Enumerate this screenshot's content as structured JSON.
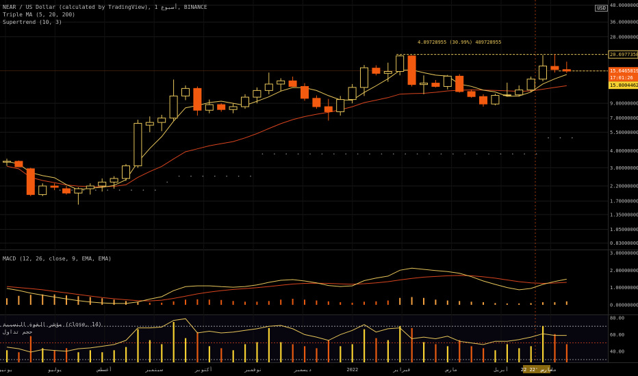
{
  "legend": {
    "main": [
      "NEAR / US Dollar (calculated by TradingView), أسبوع 1, BINANCE",
      "Triple MA (5, 20, 200)",
      "Supertrend (10, 3)"
    ],
    "macd": "MACD (12, 26, close, 9, EMA, EMA)",
    "rsi": [
      "مؤشر القوة النسبية (close, 14)",
      "حجم تداول"
    ]
  },
  "currency_badge": "USD",
  "colors": {
    "up": "#e8c65a",
    "down": "#f25a10",
    "ma_short": "#e8c65a",
    "ma_long": "#d8441e",
    "grid": "#1a1a1a",
    "dash": "#e8c65a"
  },
  "chart_data": {
    "type": "candlestick",
    "price_axis_ticks": [
      "48.00000000",
      "36.00000000",
      "28.00000000",
      "9.00000000",
      "7.00000000",
      "5.50000000",
      "4.00000000",
      "3.00000000",
      "2.20000000",
      "1.70000000",
      "1.35000000",
      "1.05000000",
      "0.83000000"
    ],
    "price_labels": {
      "top": "20.69773581",
      "current": "15.64658195",
      "countdown": "17:01:26",
      "stop": "15.80044625"
    },
    "measure_label": "4.89728955 (30.99%) 489728955",
    "candles": [
      {
        "o": 3.3,
        "h": 3.5,
        "l": 3.1,
        "c": 3.35
      },
      {
        "o": 3.35,
        "h": 3.4,
        "l": 3.05,
        "c": 3.05
      },
      {
        "o": 2.95,
        "h": 3.0,
        "l": 1.85,
        "c": 1.9
      },
      {
        "o": 1.9,
        "h": 2.3,
        "l": 1.85,
        "c": 2.2
      },
      {
        "o": 2.2,
        "h": 2.3,
        "l": 2.05,
        "c": 2.15
      },
      {
        "o": 2.1,
        "h": 2.2,
        "l": 1.9,
        "c": 1.95
      },
      {
        "o": 1.95,
        "h": 2.15,
        "l": 1.6,
        "c": 2.1
      },
      {
        "o": 2.1,
        "h": 2.3,
        "l": 1.9,
        "c": 2.2
      },
      {
        "o": 2.2,
        "h": 2.5,
        "l": 2.0,
        "c": 2.35
      },
      {
        "o": 2.35,
        "h": 2.6,
        "l": 2.1,
        "c": 2.5
      },
      {
        "o": 2.5,
        "h": 3.2,
        "l": 2.4,
        "c": 3.1
      },
      {
        "o": 3.1,
        "h": 6.8,
        "l": 3.0,
        "c": 6.4
      },
      {
        "o": 6.2,
        "h": 7.2,
        "l": 5.5,
        "c": 6.5
      },
      {
        "o": 6.5,
        "h": 7.4,
        "l": 5.6,
        "c": 7.0
      },
      {
        "o": 7.0,
        "h": 13.5,
        "l": 6.7,
        "c": 10.2
      },
      {
        "o": 10.2,
        "h": 12.2,
        "l": 9.5,
        "c": 11.6
      },
      {
        "o": 11.6,
        "h": 12.0,
        "l": 7.3,
        "c": 8.0
      },
      {
        "o": 8.0,
        "h": 9.6,
        "l": 7.6,
        "c": 8.8
      },
      {
        "o": 8.8,
        "h": 9.0,
        "l": 7.8,
        "c": 8.1
      },
      {
        "o": 8.1,
        "h": 9.0,
        "l": 7.6,
        "c": 8.5
      },
      {
        "o": 8.5,
        "h": 10.5,
        "l": 8.2,
        "c": 10.0
      },
      {
        "o": 10.0,
        "h": 11.8,
        "l": 9.0,
        "c": 11.2
      },
      {
        "o": 11.2,
        "h": 15.2,
        "l": 10.5,
        "c": 12.5
      },
      {
        "o": 12.5,
        "h": 13.8,
        "l": 11.1,
        "c": 13.2
      },
      {
        "o": 13.2,
        "h": 14.2,
        "l": 12.0,
        "c": 12.0
      },
      {
        "o": 12.0,
        "h": 12.7,
        "l": 9.4,
        "c": 9.8
      },
      {
        "o": 9.8,
        "h": 10.3,
        "l": 8.2,
        "c": 8.5
      },
      {
        "o": 8.5,
        "h": 9.7,
        "l": 6.7,
        "c": 7.8
      },
      {
        "o": 7.8,
        "h": 10.2,
        "l": 7.3,
        "c": 9.6
      },
      {
        "o": 9.6,
        "h": 12.5,
        "l": 9.0,
        "c": 11.8
      },
      {
        "o": 11.8,
        "h": 17.3,
        "l": 10.2,
        "c": 16.5
      },
      {
        "o": 16.4,
        "h": 17.2,
        "l": 14.5,
        "c": 15.0
      },
      {
        "o": 15.0,
        "h": 18.0,
        "l": 13.0,
        "c": 15.5
      },
      {
        "o": 15.5,
        "h": 20.5,
        "l": 14.5,
        "c": 20.2
      },
      {
        "o": 20.2,
        "h": 20.4,
        "l": 12.0,
        "c": 12.4
      },
      {
        "o": 12.4,
        "h": 14.5,
        "l": 10.5,
        "c": 12.7
      },
      {
        "o": 12.7,
        "h": 13.4,
        "l": 11.8,
        "c": 12.0
      },
      {
        "o": 12.0,
        "h": 14.6,
        "l": 11.4,
        "c": 14.3
      },
      {
        "o": 14.3,
        "h": 14.8,
        "l": 10.8,
        "c": 11.0
      },
      {
        "o": 11.0,
        "h": 11.4,
        "l": 9.9,
        "c": 10.1
      },
      {
        "o": 10.1,
        "h": 10.5,
        "l": 8.5,
        "c": 8.9
      },
      {
        "o": 8.9,
        "h": 10.6,
        "l": 8.7,
        "c": 10.3
      },
      {
        "o": 10.3,
        "h": 12.8,
        "l": 10.1,
        "c": 10.4
      },
      {
        "o": 10.4,
        "h": 12.2,
        "l": 10.1,
        "c": 11.3
      },
      {
        "o": 11.3,
        "h": 14.2,
        "l": 11.0,
        "c": 13.6
      },
      {
        "o": 13.6,
        "h": 20.5,
        "l": 13.1,
        "c": 17.0
      },
      {
        "o": 16.9,
        "h": 20.8,
        "l": 15.2,
        "c": 16.0
      },
      {
        "o": 16.0,
        "h": 18.3,
        "l": 15.1,
        "c": 15.6
      }
    ],
    "supertrend": [
      2.05,
      2.05,
      2.05,
      2.05,
      2.05,
      2.05,
      2.05,
      2.05,
      2.05,
      2.05,
      2.05,
      2.05,
      2.05,
      2.35,
      2.6,
      2.6,
      2.6,
      2.6,
      2.6,
      2.6,
      2.6,
      3.8,
      3.8,
      3.8,
      3.8,
      3.8,
      3.8,
      3.8,
      3.8,
      3.8,
      3.8,
      3.8,
      3.8,
      3.8,
      3.8,
      3.8,
      3.8,
      3.8,
      3.8,
      3.8,
      3.8,
      3.8,
      3.8,
      3.8,
      3.8,
      5.0,
      5.0,
      5.0
    ],
    "macd": {
      "range": [
        -0.4,
        3.0
      ],
      "ticks": [
        "3.00000000",
        "2.00000000",
        "1.00000000",
        "0.00000000"
      ],
      "macd_line": [
        0.95,
        0.83,
        0.68,
        0.56,
        0.45,
        0.34,
        0.24,
        0.16,
        0.11,
        0.08,
        0.08,
        0.17,
        0.33,
        0.47,
        0.82,
        1.05,
        1.1,
        1.1,
        1.05,
        1.02,
        1.06,
        1.15,
        1.3,
        1.42,
        1.46,
        1.38,
        1.27,
        1.12,
        1.06,
        1.1,
        1.4,
        1.55,
        1.66,
        2.0,
        2.12,
        2.05,
        1.98,
        1.92,
        1.82,
        1.63,
        1.38,
        1.18,
        1.0,
        0.87,
        0.95,
        1.18,
        1.35,
        1.48
      ],
      "signal_line": [
        1.06,
        1.0,
        0.94,
        0.87,
        0.78,
        0.69,
        0.6,
        0.51,
        0.42,
        0.35,
        0.29,
        0.24,
        0.23,
        0.27,
        0.37,
        0.5,
        0.63,
        0.74,
        0.82,
        0.89,
        0.94,
        0.99,
        1.06,
        1.13,
        1.2,
        1.24,
        1.25,
        1.24,
        1.21,
        1.19,
        1.22,
        1.27,
        1.34,
        1.44,
        1.53,
        1.6,
        1.64,
        1.68,
        1.7,
        1.68,
        1.62,
        1.54,
        1.44,
        1.34,
        1.27,
        1.24,
        1.26,
        1.3
      ],
      "histogram": [
        0.38,
        0.52,
        0.58,
        0.6,
        0.6,
        0.55,
        0.5,
        0.45,
        0.38,
        0.3,
        0.22,
        0.15,
        0.12,
        0.12,
        0.2,
        0.3,
        0.32,
        0.3,
        0.28,
        0.22,
        0.18,
        0.18,
        0.22,
        0.3,
        0.35,
        0.3,
        0.25,
        0.2,
        0.15,
        0.12,
        0.18,
        0.2,
        0.25,
        0.4,
        0.45,
        0.4,
        0.3,
        0.25,
        0.22,
        0.18,
        0.15,
        0.1,
        0.08,
        0.08,
        0.1,
        0.15,
        0.15,
        0.2
      ]
    },
    "rsi": {
      "range": [
        30,
        80
      ],
      "ticks": [
        "80.00",
        "60.00",
        "40.00"
      ],
      "overbought": 70,
      "mid": 50,
      "oversold": 30,
      "values": [
        45,
        43,
        39,
        42,
        41,
        40,
        43,
        44,
        46,
        48,
        53,
        68,
        68,
        69,
        77,
        79,
        62,
        64,
        62,
        63,
        65,
        67,
        70,
        71,
        67,
        60,
        57,
        53,
        60,
        65,
        72,
        63,
        67,
        68,
        55,
        57,
        55,
        58,
        52,
        50,
        48,
        52,
        52,
        54,
        57,
        61,
        59,
        59
      ],
      "volume": [
        0.3,
        0.25,
        0.65,
        0.35,
        0.3,
        0.35,
        0.25,
        0.3,
        0.25,
        0.3,
        0.38,
        0.82,
        0.55,
        0.45,
        1.0,
        0.6,
        0.75,
        0.4,
        0.35,
        0.3,
        0.45,
        0.5,
        0.85,
        0.5,
        0.45,
        0.4,
        0.35,
        0.55,
        0.4,
        0.45,
        0.82,
        0.6,
        0.55,
        0.9,
        0.85,
        0.5,
        0.45,
        0.4,
        0.55,
        0.4,
        0.35,
        0.3,
        0.45,
        0.35,
        0.4,
        0.9,
        0.7,
        0.45
      ]
    },
    "x_axis_labels": [
      "يونيو",
      "يوليو",
      "أغسطس",
      "سبتمبر",
      "أكتوبر",
      "نوفمبر",
      "ديسمبر",
      "2022",
      "فبراير",
      "مارس",
      "أبريل",
      "مايو"
    ],
    "x_axis_highlight": "22 مارس '22"
  }
}
